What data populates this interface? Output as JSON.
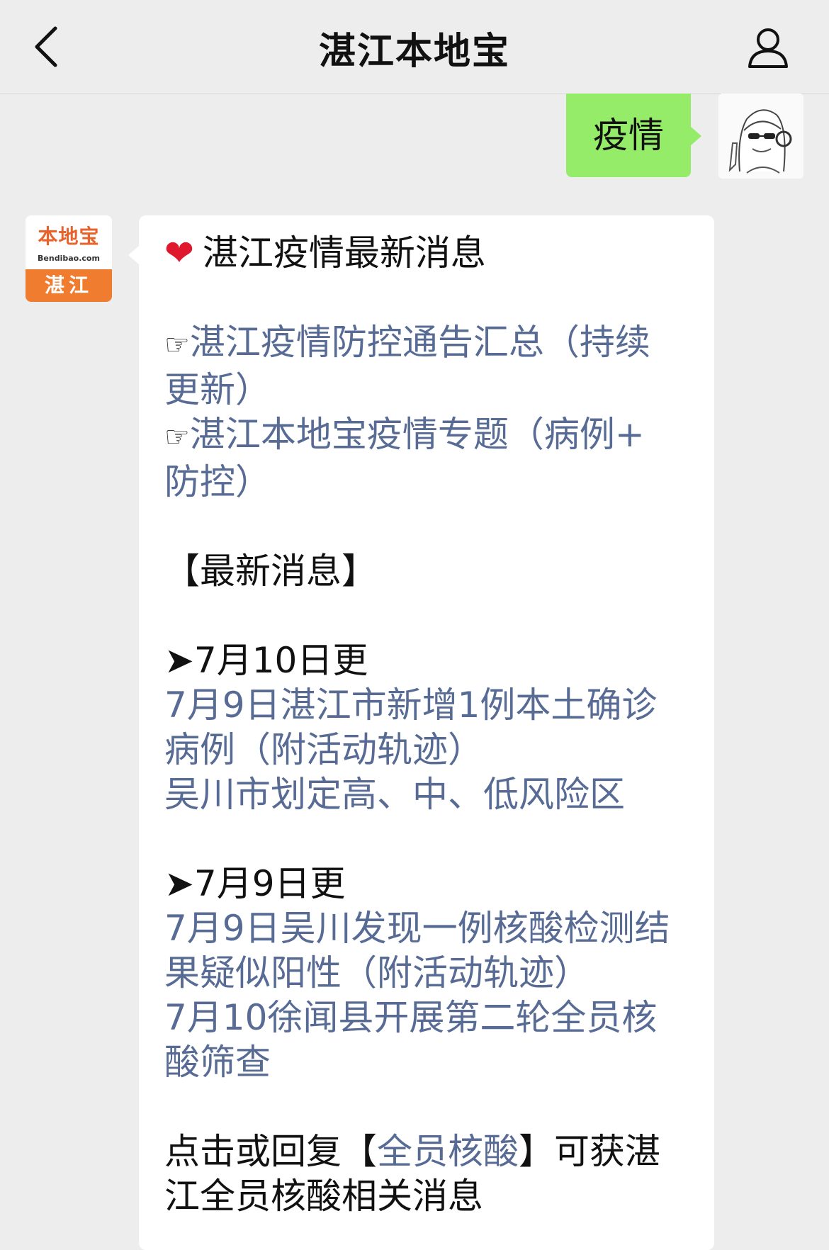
{
  "header": {
    "title": "湛江本地宝"
  },
  "user_message": {
    "text": "疫情"
  },
  "bot_avatar": {
    "brand": "本地宝",
    "domain": "Bendibao.com",
    "city": "湛江"
  },
  "message": {
    "heading": "湛江疫情最新消息",
    "pointer_glyph": "☞",
    "links_top": [
      {
        "line1": "湛江疫情防控通告汇总（持续",
        "line2": "更新）"
      },
      {
        "line1": "湛江本地宝疫情专题（病例+",
        "line2": "防控）"
      }
    ],
    "latest_label": "【最新消息】",
    "updates": [
      {
        "date": "➤7月10日更",
        "items": [
          "7月9日湛江市新增1例本土确诊",
          "病例（附活动轨迹）",
          "吴川市划定高、中、低风险区"
        ]
      },
      {
        "date": "➤7月9日更",
        "items": [
          "7月9日吴川发现一例核酸检测结",
          "果疑似阳性（附活动轨迹）",
          "7月10徐闻县开展第二轮全员核",
          "酸筛查"
        ]
      }
    ],
    "footer": {
      "prefix": "点击或回复【",
      "keyword": "全员核酸",
      "suffix": "】可获湛",
      "line2": "江全员核酸相关消息"
    }
  },
  "colors": {
    "background": "#ededed",
    "user_bubble": "#95ec69",
    "link": "#576b95",
    "heart": "#e0182d",
    "brand_orange": "#f07c2f"
  },
  "icons": [
    "back-arrow-icon",
    "profile-icon",
    "heart-icon",
    "pointing-hand-icon"
  ]
}
